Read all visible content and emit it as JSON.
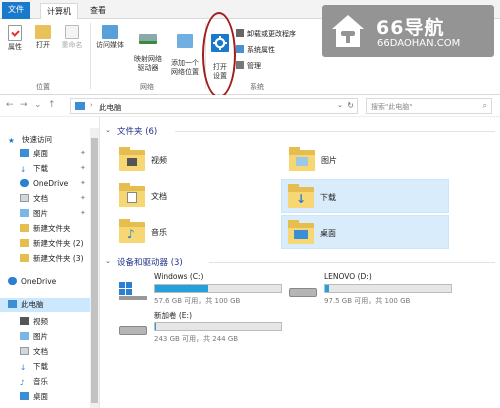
{
  "tabs": {
    "file": "文件",
    "computer": "计算机",
    "view": "查看"
  },
  "ribbon": {
    "location": {
      "properties": "属性",
      "open": "打开",
      "rename": "重命名",
      "group": "位置"
    },
    "network": {
      "media": "访问媒体",
      "map_drive": "映射网络\n驱动器",
      "add_location": "添加一个\n网络位置",
      "group": "网络"
    },
    "system": {
      "open_settings": "打开\n设置",
      "uninstall": "卸载或更改程序",
      "system_properties": "系统属性",
      "manage": "管理",
      "group": "系统"
    }
  },
  "watermark": {
    "title": "66导航",
    "subtitle": "66DAOHAN.COM"
  },
  "address": {
    "path": "此电脑",
    "search_placeholder": "搜索\"此电脑\""
  },
  "sidebar": {
    "quick_access": "快速访问",
    "items": [
      "桌面",
      "下载",
      "OneDrive",
      "文档",
      "图片",
      "新建文件夹",
      "新建文件夹 (2)",
      "新建文件夹 (3)"
    ],
    "onedrive": "OneDrive",
    "this_pc": "此电脑",
    "pc_items": [
      "视频",
      "图片",
      "文档",
      "下载",
      "音乐",
      "桌面"
    ]
  },
  "folders": {
    "header": "文件夹 (6)",
    "items": [
      "视频",
      "图片",
      "文档",
      "下载",
      "音乐",
      "桌面"
    ]
  },
  "drives": {
    "header": "设备和驱动器 (3)",
    "items": [
      {
        "name": "Windows (C:)",
        "free": "57.6 GB 可用，共 100 GB",
        "used": 0.42
      },
      {
        "name": "LENOVO (D:)",
        "free": "97.5 GB 可用，共 100 GB",
        "used": 0.03
      },
      {
        "name": "新加卷 (E:)",
        "free": "243 GB 可用，共 244 GB",
        "used": 0.01
      }
    ]
  }
}
